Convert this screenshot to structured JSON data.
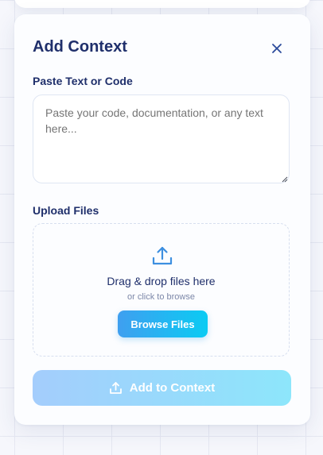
{
  "modal": {
    "title": "Add Context",
    "close_icon": "close-icon"
  },
  "paste_section": {
    "label": "Paste Text or Code",
    "placeholder": "Paste your code, documentation, or any text here...",
    "value": ""
  },
  "upload_section": {
    "label": "Upload Files",
    "icon": "upload-icon",
    "drop_text": "Drag & drop files here",
    "browse_hint": "or click to browse",
    "browse_button": "Browse Files"
  },
  "submit": {
    "label": "Add to Context",
    "icon": "upload-icon",
    "enabled": false
  },
  "colors": {
    "heading": "#1f2f6b",
    "accent_start": "#3f9ff0",
    "accent_end": "#0bcbf3",
    "disabled_start": "#a4cdfc",
    "disabled_end": "#8de6fb"
  }
}
